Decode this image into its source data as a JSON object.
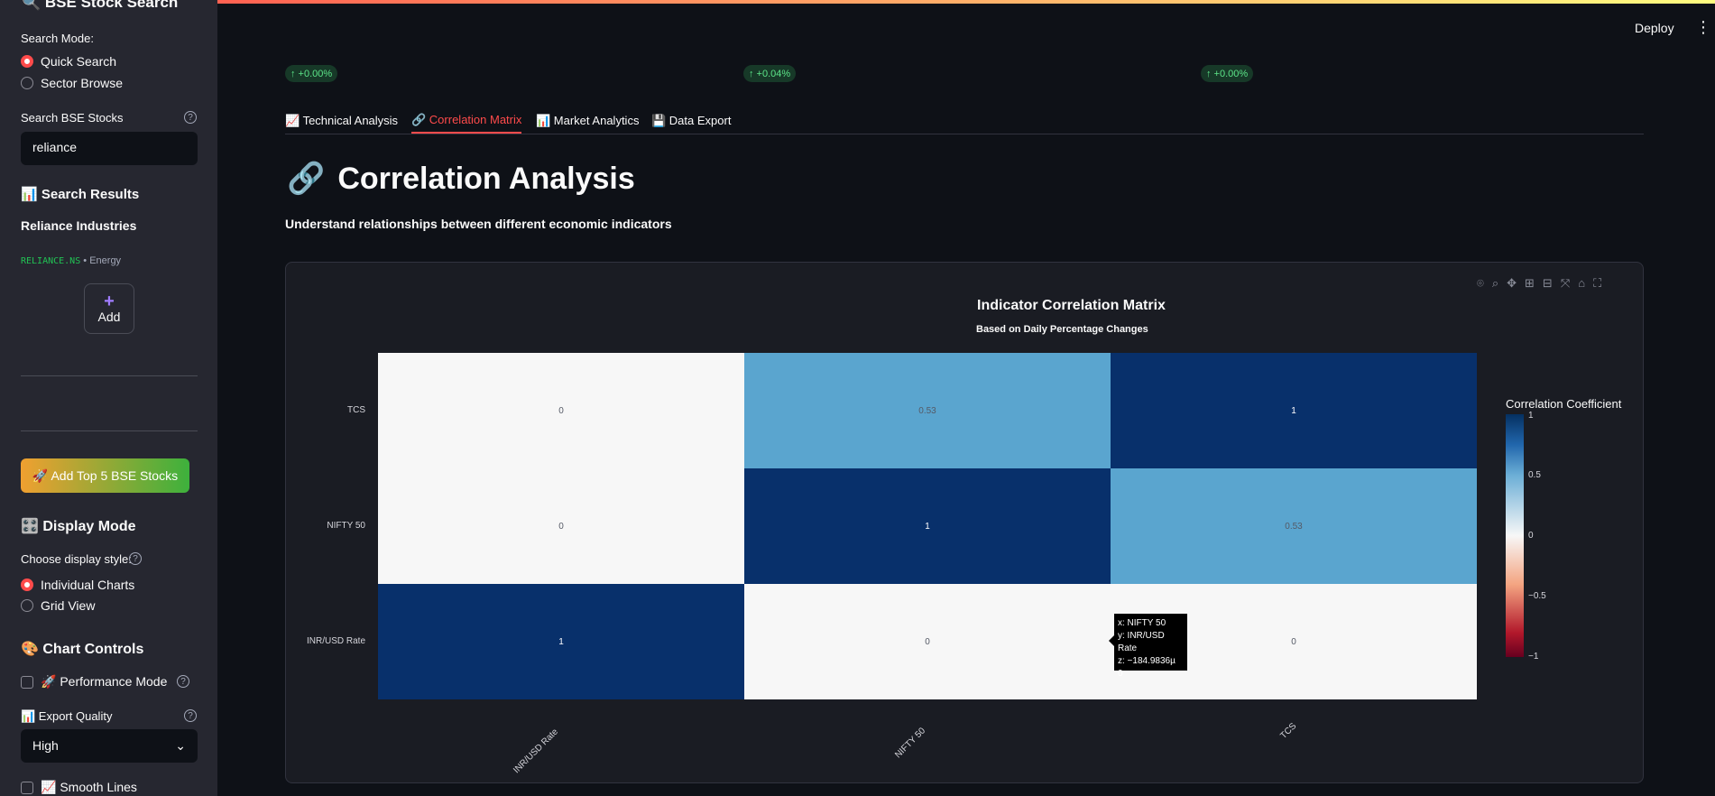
{
  "sidebar": {
    "title": "🔍 BSE Stock Search",
    "search_mode_label": "Search Mode:",
    "search_modes": [
      "Quick Search",
      "Sector Browse"
    ],
    "search_label": "Search BSE Stocks",
    "search_value": "reliance",
    "results_header": "📊 Search Results",
    "result_name": "Reliance Industries",
    "result_ticker": "RELIANCE.NS",
    "result_sector": "• Energy",
    "add_label": "Add",
    "top5_label": "🚀 Add Top 5 BSE Stocks",
    "display_header": "🎛️ Display Mode",
    "display_style_label": "Choose display style:",
    "display_styles": [
      "Individual Charts",
      "Grid View"
    ],
    "chart_controls_header": "🎨 Chart Controls",
    "performance_label": "🚀 Performance Mode",
    "export_quality_label": "📊 Export Quality",
    "export_quality_value": "High",
    "smooth_lines_label": "📈 Smooth Lines"
  },
  "header": {
    "deploy": "Deploy",
    "menu": "⋮"
  },
  "deltas": [
    "↑ +0.00%",
    "↑ +0.04%",
    "↑ +0.00%"
  ],
  "tabs": [
    {
      "label": "📈 Technical Analysis"
    },
    {
      "label": "🔗 Correlation Matrix"
    },
    {
      "label": "📊 Market Analytics"
    },
    {
      "label": "💾 Data Export"
    }
  ],
  "page": {
    "title_icon": "🔗",
    "title": "Correlation Analysis",
    "subtitle": "Understand relationships between different economic indicators"
  },
  "modebar_icons": [
    "camera-icon",
    "zoom-icon",
    "pan-icon",
    "zoom-in-icon",
    "zoom-out-icon",
    "autoscale-icon",
    "reset-icon",
    "fullscreen-icon"
  ],
  "chart_data": {
    "type": "heatmap",
    "title": "Indicator Correlation Matrix",
    "subtitle": "Based on Daily Percentage Changes",
    "x": [
      "INR/USD Rate",
      "NIFTY 50",
      "TCS"
    ],
    "y": [
      "TCS",
      "NIFTY 50",
      "INR/USD Rate"
    ],
    "z": [
      [
        0,
        0.53,
        1
      ],
      [
        0,
        1,
        0.53
      ],
      [
        1,
        0,
        0
      ]
    ],
    "colorbar_title": "Correlation Coefficient",
    "colorbar_ticks": [
      "1",
      "0.5",
      "0",
      "−0.5",
      "−1"
    ],
    "zlim": [
      -1,
      1
    ],
    "tooltip": [
      "x: NIFTY 50",
      "y: INR/USD Rate",
      "z: −184.9836µ",
      "0"
    ]
  }
}
